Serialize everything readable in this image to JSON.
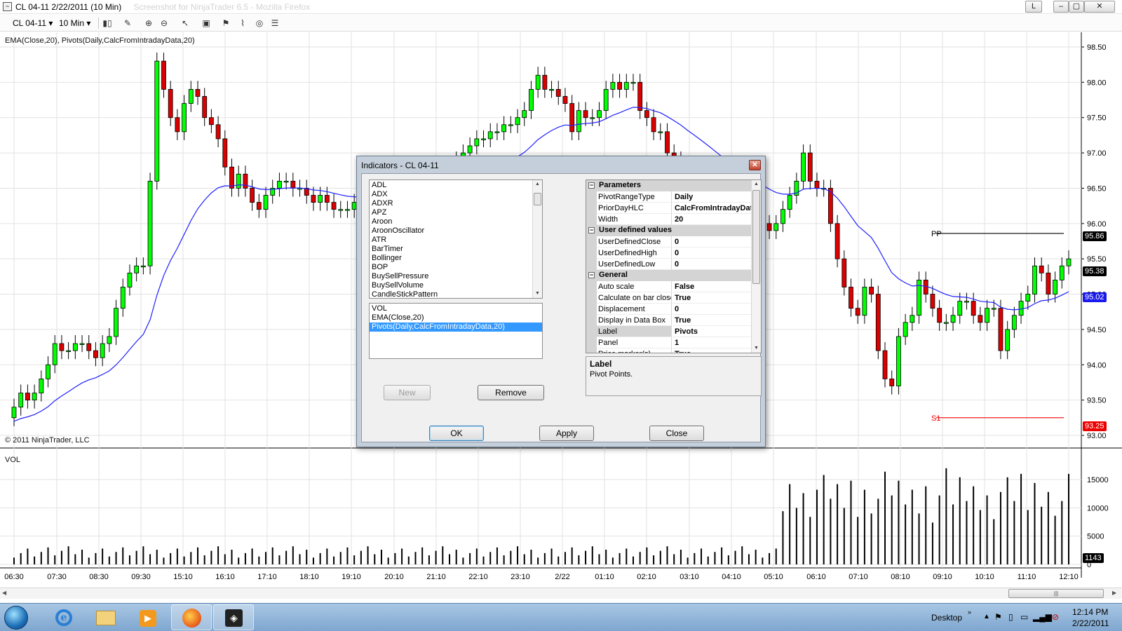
{
  "window": {
    "title": "CL 04-11  2/22/2011 (10 Min)",
    "title_faded": "Screenshot for NinjaTrader 6.5 - Mozilla Firefox",
    "buttons": [
      "L",
      "–",
      "▢",
      "✕"
    ]
  },
  "toolbar": {
    "instrument": "CL 04-11",
    "interval": "10 Min",
    "icons": [
      "candlestick-icon",
      "pencil-icon",
      "zoom-in-icon",
      "zoom-out-icon",
      "properties-icon",
      "cursor-icon",
      "drawing-icon",
      "indicators-icon",
      "strategies-icon",
      "data-box-icon",
      "print-icon"
    ]
  },
  "chart": {
    "indicator_label": "EMA(Close,20), Pivots(Daily,CalcFromIntradayData,20)",
    "copyright": "© 2011 NinjaTrader, LLC",
    "volume_label": "VOL",
    "price_ticks": [
      "98.50",
      "98.00",
      "97.50",
      "97.00",
      "96.50",
      "96.00",
      "95.50",
      "95.00",
      "94.50",
      "94.00",
      "93.50",
      "93.00"
    ],
    "volume_ticks": [
      "15000",
      "10000",
      "5000",
      "0"
    ],
    "time_ticks": [
      "06:30",
      "07:30",
      "08:30",
      "09:30",
      "15:10",
      "16:10",
      "17:10",
      "18:10",
      "19:10",
      "20:10",
      "21:10",
      "22:10",
      "23:10",
      "2/22",
      "01:10",
      "02:10",
      "03:10",
      "04:10",
      "05:10",
      "06:10",
      "07:10",
      "08:10",
      "09:10",
      "10:10",
      "11:10",
      "12:10"
    ],
    "pivot_labels": {
      "pp": "PP",
      "s1": "S1"
    },
    "tags": {
      "pp": "95.86",
      "last": "95.38",
      "ema": "95.02",
      "s1": "93.25",
      "volume": "1143"
    },
    "colors": {
      "up": "#00ff00",
      "down": "#dd0000",
      "ema": "#2020ff",
      "pp": "#000000",
      "s1": "#ee0000"
    }
  },
  "dialog": {
    "title": "Indicators - CL 04-11",
    "available": [
      "ADL",
      "ADX",
      "ADXR",
      "APZ",
      "Aroon",
      "AroonOscillator",
      "ATR",
      "BarTimer",
      "Bollinger",
      "BOP",
      "BuySellPressure",
      "BuySellVolume",
      "CandleStickPattern"
    ],
    "applied": [
      "VOL",
      "EMA(Close,20)",
      "Pivots(Daily,CalcFromIntradayData,20)"
    ],
    "buttons": {
      "new": "New",
      "remove": "Remove",
      "ok": "OK",
      "apply": "Apply",
      "close": "Close"
    },
    "grid": [
      {
        "type": "category",
        "name": "Parameters"
      },
      {
        "type": "prop",
        "name": "PivotRangeType",
        "value": "Daily"
      },
      {
        "type": "prop",
        "name": "PriorDayHLC",
        "value": "CalcFromIntradayData"
      },
      {
        "type": "prop",
        "name": "Width",
        "value": "20"
      },
      {
        "type": "category",
        "name": "User defined values"
      },
      {
        "type": "prop",
        "name": "UserDefinedClose",
        "value": "0"
      },
      {
        "type": "prop",
        "name": "UserDefinedHigh",
        "value": "0"
      },
      {
        "type": "prop",
        "name": "UserDefinedLow",
        "value": "0"
      },
      {
        "type": "category",
        "name": "General"
      },
      {
        "type": "prop",
        "name": "Auto scale",
        "value": "False"
      },
      {
        "type": "prop",
        "name": "Calculate on bar close",
        "value": "True"
      },
      {
        "type": "prop",
        "name": "Displacement",
        "value": "0"
      },
      {
        "type": "prop",
        "name": "Display in Data Box",
        "value": "True"
      },
      {
        "type": "prop",
        "name": "Label",
        "value": "Pivots",
        "selected": true
      },
      {
        "type": "prop",
        "name": "Panel",
        "value": "1"
      },
      {
        "type": "prop",
        "name": "Price marker(s)",
        "value": "True"
      }
    ],
    "description": {
      "title": "Label",
      "text": "Pivot Points."
    }
  },
  "taskbar": {
    "apps": [
      "start-orb",
      "internet-explorer-icon",
      "windows-explorer-icon",
      "media-player-icon",
      "firefox-icon",
      "ninjatrader-icon"
    ],
    "desktop_label": "Desktop",
    "time": "12:14 PM",
    "date": "2/22/2011"
  }
}
